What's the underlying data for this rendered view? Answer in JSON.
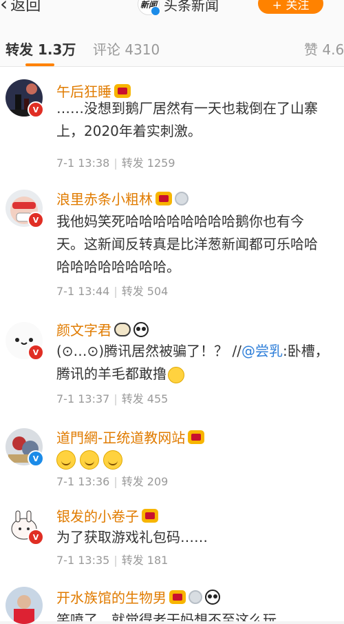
{
  "nav": {
    "back_label": "返回",
    "brand_logo_text": "新闻",
    "brand_name": "头条新闻",
    "follow_label": "+ 关注"
  },
  "tabs": [
    {
      "label": "转发 1.3万",
      "active": true
    },
    {
      "label": "评论 4310",
      "active": false
    },
    {
      "label": "赞 4.6",
      "active": false
    }
  ],
  "reposts": [
    {
      "username": "午后狂睡",
      "badges": [
        "vip-crown-icon"
      ],
      "avatar_badge": "V",
      "lines": [
        "……没想到鹅厂居然有一天也栽倒在了山寨",
        "上，2020年着实刺激。"
      ],
      "time": "7-1 13:38",
      "repost": "转发 1259"
    },
    {
      "username": "浪里赤条小粗林",
      "badges": [
        "vip-crown-icon",
        "medal-icon"
      ],
      "avatar_badge": "V",
      "lines": [
        "我他妈笑死哈哈哈哈哈哈哈哈鹅你也有今",
        "天。这新闻反转真是比洋葱新闻都可乐哈哈",
        "哈哈哈哈哈哈哈哈。"
      ],
      "time": "7-1 13:44",
      "repost": "转发 504"
    },
    {
      "username": "颜文字君",
      "badges": [
        "sheep-icon",
        "panda-icon"
      ],
      "avatar_badge": "V",
      "line1_prefix": "(⊙…⊙)腾讯居然被骗了！？ //",
      "mention": "@尝乳",
      "line1_suffix": ":卧槽，",
      "line2": "腾讯的羊毛都敢撸",
      "time": "7-1 13:37",
      "repost": "转发 455"
    },
    {
      "username": "道門網-正统道教网站",
      "badges": [
        "vip-crown-icon"
      ],
      "avatar_badge": "V",
      "emoji_count": 3,
      "time": "7-1 13:36",
      "repost": "转发 209"
    },
    {
      "username": "银发的小卷子",
      "badges": [
        "vip-crown-icon"
      ],
      "avatar_badge": "V",
      "lines": [
        "为了获取游戏礼包码……"
      ],
      "time": "7-1 13:35",
      "repost": "转发 181"
    },
    {
      "username": "开水族馆的生物男",
      "badges": [
        "vip-crown-icon",
        "medal-icon",
        "panda-icon"
      ],
      "lines": [
        "笑喷了，就觉得老干妈想不至这么玩"
      ]
    }
  ],
  "colors": {
    "accent": "#ff8200",
    "username": "#e07b00",
    "mention": "#2f7fd9",
    "vip_badge": "#e02e24",
    "verified_badge": "#1b8be8"
  }
}
